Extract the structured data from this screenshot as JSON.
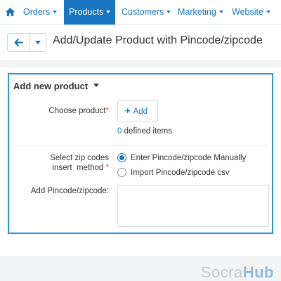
{
  "nav": {
    "items": [
      {
        "label": "Orders"
      },
      {
        "label": "Products"
      },
      {
        "label": "Customers"
      },
      {
        "label": "Marketing"
      },
      {
        "label": "Website"
      }
    ],
    "active": "Products"
  },
  "header": {
    "title": "Add/Update Product with Pincode/zipcode"
  },
  "section": {
    "title": "Add new product"
  },
  "form": {
    "choose_product_label": "Choose product",
    "required_mark": "*",
    "add_button_label": "Add",
    "defined_count": "0",
    "defined_suffix": " defined items",
    "method_label_line1": "Select zip codes",
    "method_label_line2": "insert  method",
    "radio_manual": "Enter Pincode/zipcode Manually",
    "radio_csv": "Import Pincode/zipcode csv",
    "selected_method": "manual",
    "pincode_label": "Add Pincode/zipcode:",
    "pincode_value": ""
  },
  "watermark": {
    "part1": "Socra",
    "part2": "Hub"
  },
  "colors": {
    "accent": "#1775c1",
    "panel_border": "#2597d5",
    "required": "#d9534f"
  }
}
